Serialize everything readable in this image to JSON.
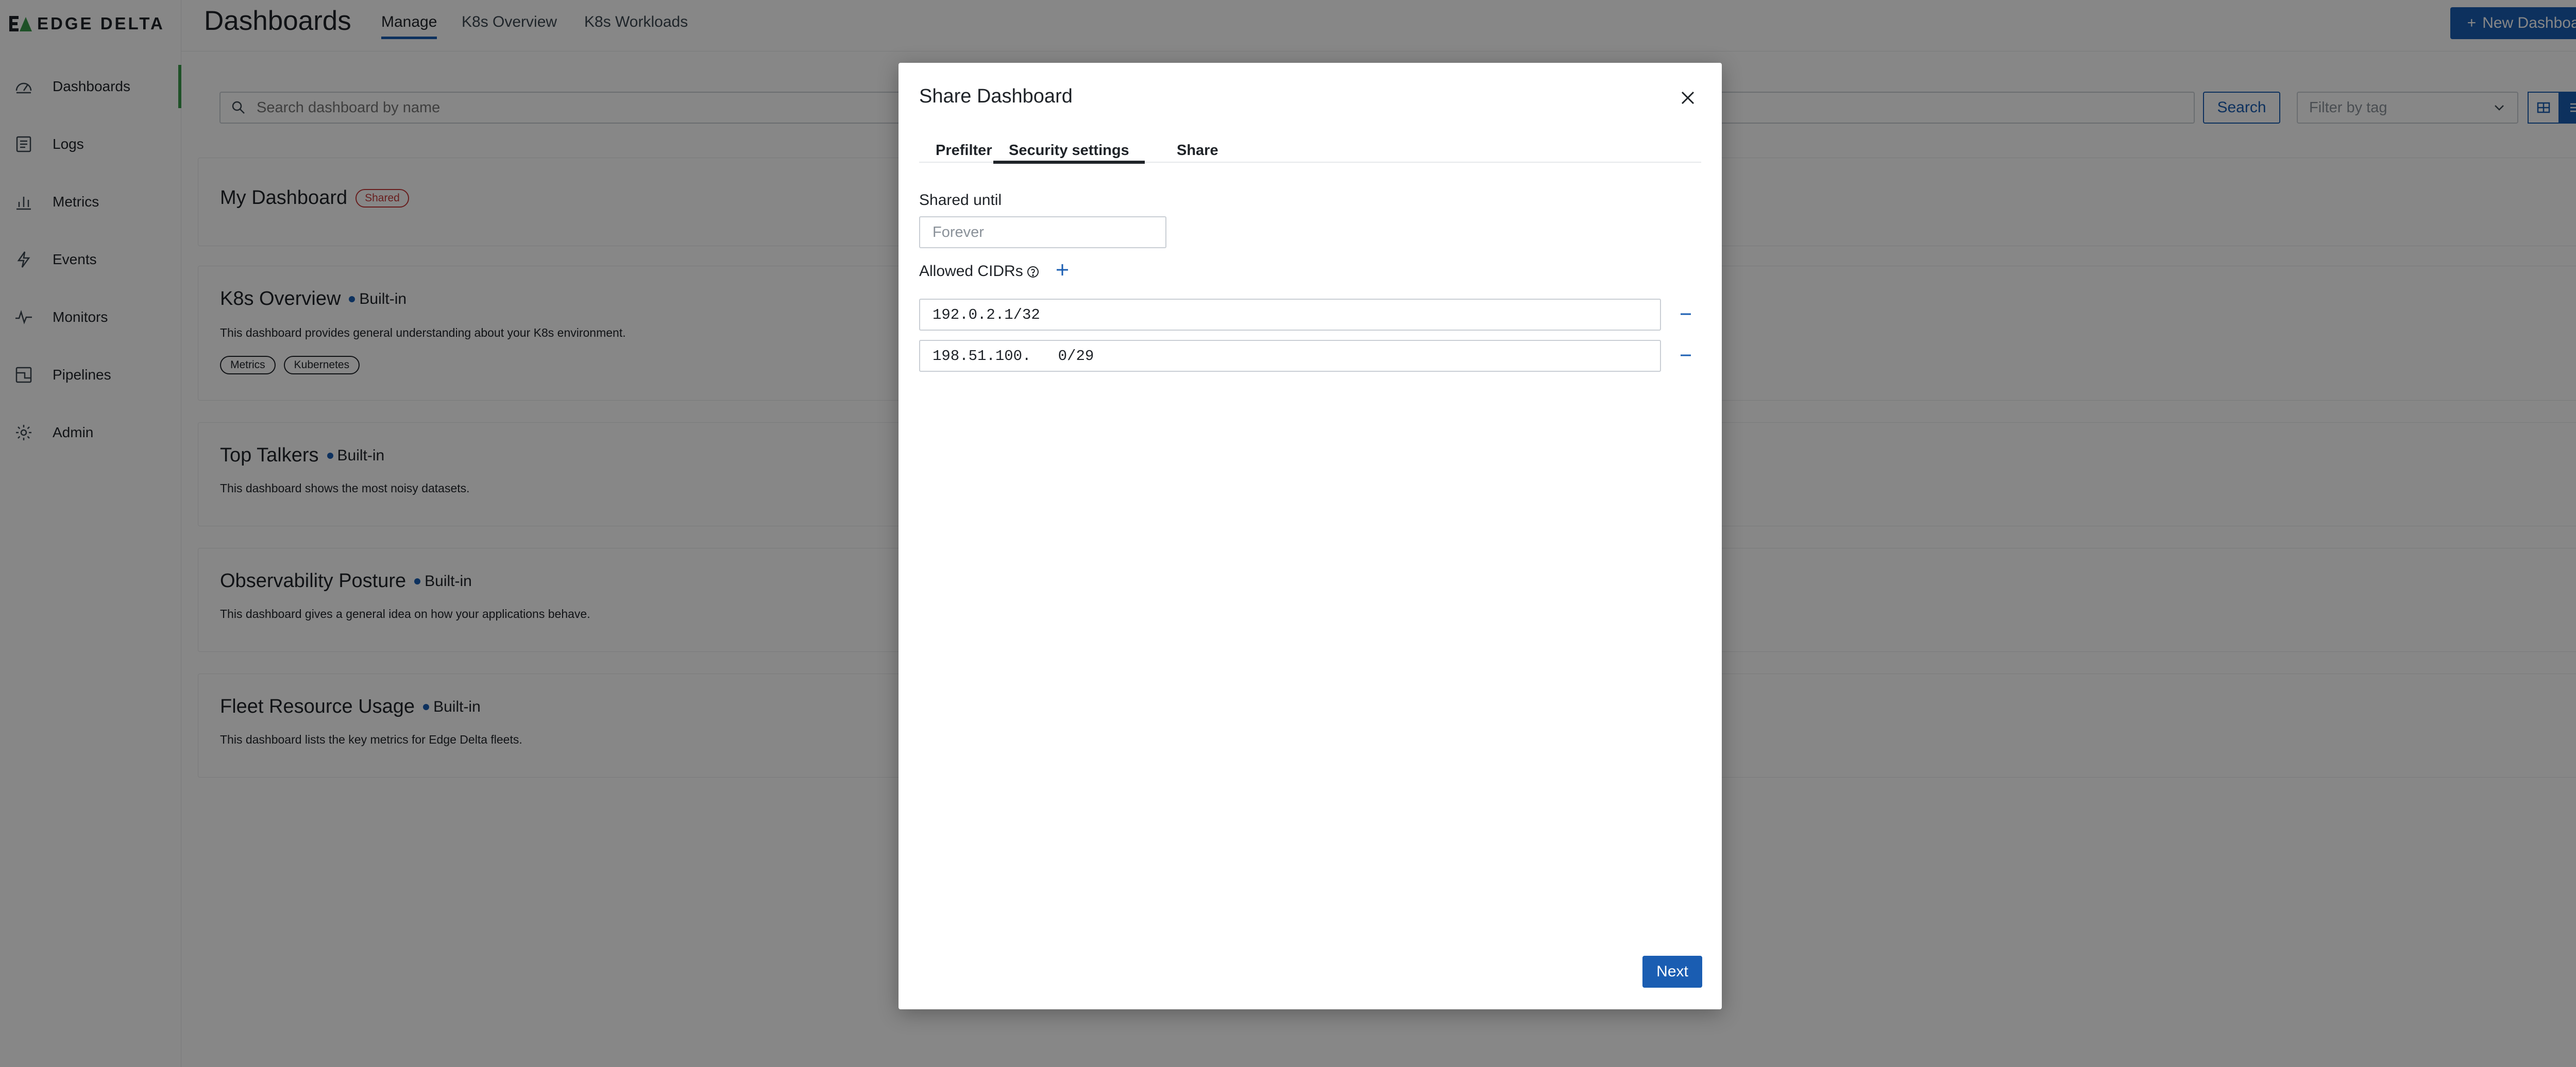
{
  "brand": {
    "logo_text_a": "ED",
    "logo_text_b": "GE DELTA",
    "accent": "#3a9a4a",
    "primary": "#1a5db2"
  },
  "sidebar": {
    "items": [
      {
        "label": "Dashboards",
        "icon": "dashboard-gauge-icon",
        "active": true
      },
      {
        "label": "Logs",
        "icon": "logs-icon"
      },
      {
        "label": "Metrics",
        "icon": "metrics-bar-icon"
      },
      {
        "label": "Events",
        "icon": "events-bolt-icon"
      },
      {
        "label": "Monitors",
        "icon": "monitors-pulse-icon"
      },
      {
        "label": "Pipelines",
        "icon": "pipelines-icon"
      },
      {
        "label": "Admin",
        "icon": "admin-gear-icon"
      }
    ]
  },
  "header": {
    "title": "Dashboards",
    "tabs": [
      {
        "label": "Manage",
        "active": true
      },
      {
        "label": "K8s Overview"
      },
      {
        "label": "K8s Workloads"
      }
    ],
    "new_button": "New Dashboard"
  },
  "toolbar": {
    "search_placeholder": "Search dashboard by name",
    "search_button": "Search",
    "filter_placeholder": "Filter by tag"
  },
  "dashboards": [
    {
      "title": "My Dashboard",
      "badge": "Shared"
    },
    {
      "title": "K8s Overview",
      "kind": "Built-in",
      "description": "This dashboard provides general understanding about your K8s environment.",
      "tags": [
        "Metrics",
        "Kubernetes"
      ]
    },
    {
      "title": "Top Talkers",
      "kind": "Built-in",
      "description": "This dashboard shows the most noisy datasets."
    },
    {
      "title": "Observability Posture",
      "kind": "Built-in",
      "description": "This dashboard gives a general idea on how your applications behave."
    },
    {
      "title": "Fleet Resource Usage",
      "kind": "Built-in",
      "description": "This dashboard lists the key metrics for Edge Delta fleets."
    }
  ],
  "modal": {
    "title": "Share Dashboard",
    "tabs": [
      {
        "label": "Prefilter"
      },
      {
        "label": "Security settings",
        "active": true
      },
      {
        "label": "Share"
      }
    ],
    "shared_until_label": "Shared until",
    "shared_until_placeholder": "Forever",
    "allowed_cidrs_label": "Allowed CIDRs",
    "cidrs": [
      "192.0.2.1/32",
      "198.51.100.   0/29"
    ],
    "next_button": "Next"
  }
}
